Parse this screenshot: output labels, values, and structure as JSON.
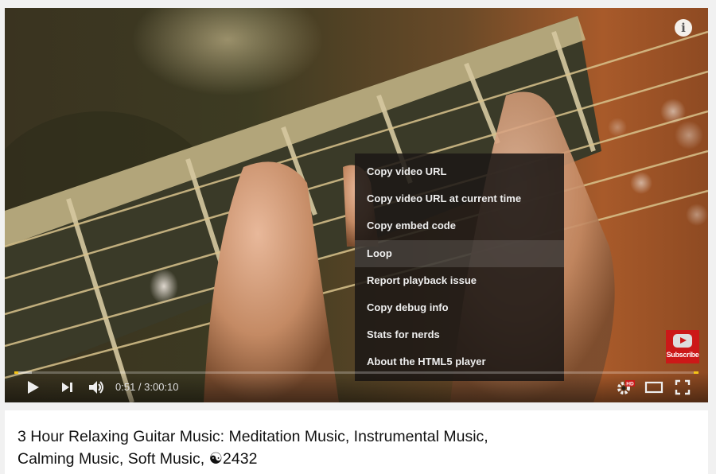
{
  "player": {
    "info_icon": "i",
    "context_menu": {
      "items": [
        {
          "label": "Copy video URL"
        },
        {
          "label": "Copy video URL at current time"
        },
        {
          "label": "Copy embed code"
        },
        {
          "label": "Loop",
          "highlighted": true
        },
        {
          "label": "Report playback issue"
        },
        {
          "label": "Copy debug info"
        },
        {
          "label": "Stats for nerds"
        },
        {
          "label": "About the HTML5 player"
        }
      ]
    },
    "subscribe_label": "Subscribe",
    "progress": {
      "played_fraction": 0.0047,
      "buffered_fraction": 0.025
    },
    "controls": {
      "current_time": "0:51",
      "duration": "3:00:10",
      "time_display": "0:51 / 3:00:10",
      "hd_badge": "HD",
      "icons": [
        "play-icon",
        "next-icon",
        "volume-icon",
        "settings-icon",
        "theater-mode-icon",
        "fullscreen-icon"
      ]
    },
    "accent_color": "#f5c518",
    "subscribe_color": "#cc1818"
  },
  "video_info": {
    "title_line1": "3 Hour Relaxing Guitar Music: Meditation Music, Instrumental Music,",
    "title_line2": "Calming Music, Soft Music, ☯2432"
  }
}
